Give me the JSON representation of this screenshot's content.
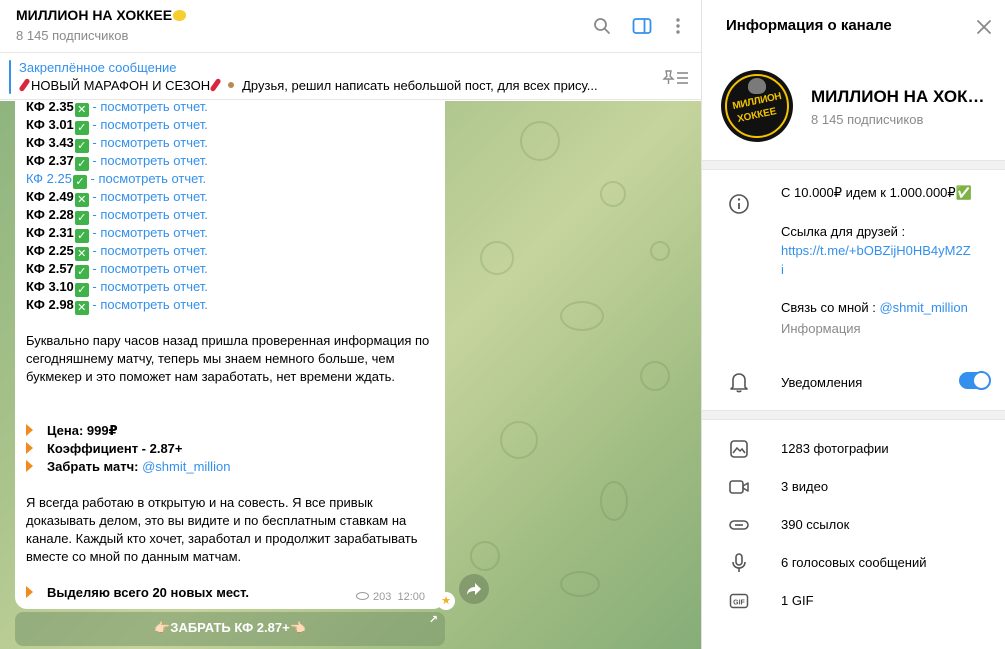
{
  "chat": {
    "title": "МИЛЛИОН НА ХОККЕЕ",
    "subscribers": "8 145 подписчиков",
    "pinned_label": "Закреплённое сообщение",
    "pinned_text_a": "НОВЫЙ МАРАФОН И СЕЗОН",
    "pinned_text_b": "Друзья, решил написать небольшой пост, для всех прису..."
  },
  "message": {
    "kf_rows": [
      {
        "k": "КФ 2.35",
        "mark": "✕",
        "r": " - посмотреть отчет."
      },
      {
        "k": "КФ 3.01",
        "mark": "✓",
        "r": " - посмотреть отчет."
      },
      {
        "k": "КФ 3.43",
        "mark": "✓",
        "r": " - посмотреть отчет."
      },
      {
        "k": "КФ 2.37",
        "mark": "✓",
        "r": " - посмотреть отчет."
      },
      {
        "k": "КФ 2.25",
        "mark": "✓",
        "r": " - посмотреть отчет."
      },
      {
        "k": "КФ 2.49",
        "mark": "✕",
        "r": " - посмотреть отчет."
      },
      {
        "k": "КФ 2.28",
        "mark": "✓",
        "r": " - посмотреть отчет."
      },
      {
        "k": "КФ 2.31",
        "mark": "✓",
        "r": " - посмотреть отчет."
      },
      {
        "k": "КФ 2.25",
        "mark": "✕",
        "r": " - посмотреть отчет."
      },
      {
        "k": "КФ 2.57",
        "mark": "✓",
        "r": " - посмотреть отчет."
      },
      {
        "k": "КФ 3.10",
        "mark": "✓",
        "r": " - посмотреть отчет."
      },
      {
        "k": "КФ 2.98",
        "mark": "✕",
        "r": " - посмотреть отчет."
      }
    ],
    "para1": "Буквально пару часов назад пришла проверенная информация по сегодняшнему матчу, теперь мы знаем немного больше, чем букмекер и это поможет нам заработать, нет времени ждать.",
    "price_label": "Цена: 999₽",
    "coef_label": "Коэффициент - 2.87+",
    "match_label": "Забрать матч:",
    "match_link": "@shmit_million",
    "para2": "Я всегда работаю в открытую и на совесть. Я все привык доказывать делом, это вы видите и по бесплатным ставкам на канале. Каждый кто хочет, заработал и продолжит зарабатывать вместе со мной по данным матчам.",
    "places": "Выделяю всего 20 новых мест.",
    "views": "203",
    "time": "12:00",
    "button": "👉🏻ЗАБРАТЬ КФ 2.87+👈🏻"
  },
  "info": {
    "title": "Информация о канале",
    "channel_name": "МИЛЛИОН НА ХОККЕЕ",
    "subscribers": "8 145 подписчиков",
    "avatar_line1": "МИЛЛИОН",
    "avatar_line2": "ХОККЕЕ",
    "description": "С 10.000₽ идем к 1.000.000₽✅",
    "friends_label": "Ссылка для друзей :",
    "friends_link_a": "https://t.me/+bOBZijH0HB4yM2Z",
    "friends_link_b": "i",
    "contact_label": "Связь со мной : ",
    "contact_link": "@shmit_million",
    "info_label": "Информация",
    "notifications": "Уведомления",
    "notifications_on": true,
    "media": [
      {
        "icon": "photo-icon",
        "label": "1283 фотографии"
      },
      {
        "icon": "video-icon",
        "label": "3 видео"
      },
      {
        "icon": "link-icon",
        "label": "390 ссылок"
      },
      {
        "icon": "microphone-icon",
        "label": "6 голосовых сообщений"
      },
      {
        "icon": "gif-icon",
        "label": "1 GIF"
      }
    ]
  },
  "colors": {
    "accent": "#3390ec",
    "check": "#40b24a",
    "bullet": "#f28a1d",
    "avatar_gold": "#f3c300"
  }
}
